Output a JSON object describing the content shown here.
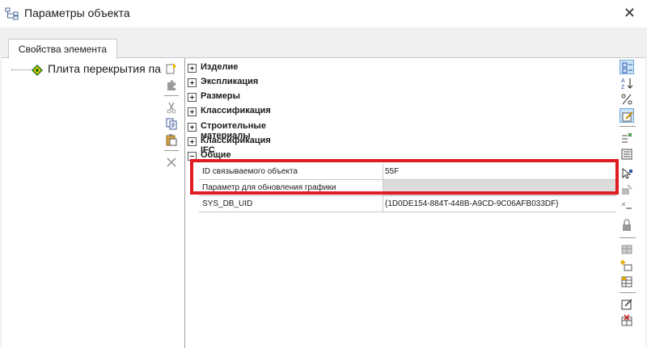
{
  "window": {
    "title": "Параметры объекта"
  },
  "tab": {
    "label": "Свойства элемента"
  },
  "tree": {
    "item_label": "Плита перекрытия пар"
  },
  "categories": [
    {
      "label": "Изделие",
      "expanded": false
    },
    {
      "label": "Экспликация",
      "expanded": false
    },
    {
      "label": "Размеры",
      "expanded": false
    },
    {
      "label": "Классификация",
      "expanded": false
    },
    {
      "label": "Строительные материалы",
      "expanded": false
    },
    {
      "label": "Классификация IFC",
      "expanded": false
    },
    {
      "label": "Общие",
      "expanded": true
    }
  ],
  "properties": [
    {
      "name": "ID связываемого объекта",
      "value": "55F"
    },
    {
      "name": "Параметр для обновления графики",
      "value": ""
    },
    {
      "name": "SYS_DB_UID",
      "value": "{1D0DE154-884T-448B-A9CD-9C06AFB033DF}"
    }
  ],
  "colors": {
    "highlight": "#e01b24",
    "accent": "#cde3f7"
  }
}
